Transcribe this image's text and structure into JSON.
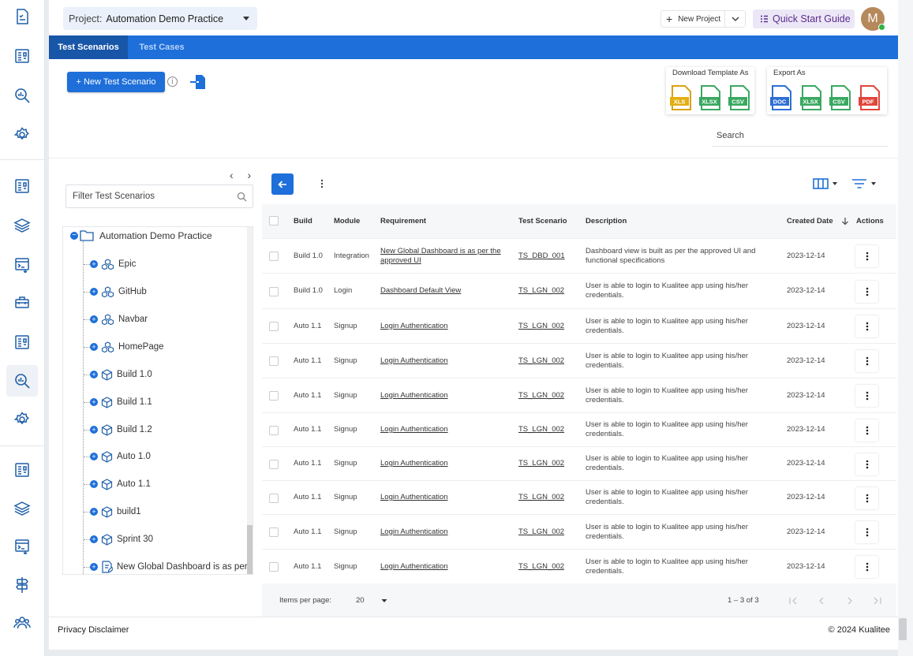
{
  "topbar": {
    "project_label": "Project:",
    "project_value": "Automation Demo Practice",
    "new_project": "New Project",
    "quick_start": "Quick Start Guide",
    "avatar_initial": "M"
  },
  "tabs": [
    {
      "label": "Test Scenarios",
      "active": true
    },
    {
      "label": "Test Cases",
      "active": false
    }
  ],
  "actions": {
    "new_scenario": "+ New Test Scenario",
    "info_glyph": "i",
    "download_title": "Download Template As",
    "download_formats": [
      "XLS",
      "XLSX",
      "CSV"
    ],
    "export_title": "Export As",
    "export_formats": [
      "DOC",
      "XLSX",
      "CSV",
      "PDF"
    ],
    "search_placeholder": "Search"
  },
  "tree": {
    "nav": "‹ ›",
    "filter_placeholder": "Filter Test Scenarios",
    "root": "Automation Demo Practice",
    "items": [
      {
        "label": "Epic",
        "icon": "modules-icon"
      },
      {
        "label": "GitHub",
        "icon": "modules-icon"
      },
      {
        "label": "Navbar",
        "icon": "modules-icon"
      },
      {
        "label": "HomePage",
        "icon": "modules-icon"
      },
      {
        "label": "Build 1.0",
        "icon": "cube-icon"
      },
      {
        "label": "Build 1.1",
        "icon": "cube-icon"
      },
      {
        "label": "Build 1.2",
        "icon": "cube-icon"
      },
      {
        "label": "Auto 1.0",
        "icon": "cube-icon"
      },
      {
        "label": "Auto 1.1",
        "icon": "cube-icon"
      },
      {
        "label": "build1",
        "icon": "cube-icon"
      },
      {
        "label": "Sprint 30",
        "icon": "cube-icon"
      },
      {
        "label": "New Global Dashboard is as per t",
        "icon": "doc-edit-icon"
      }
    ]
  },
  "table": {
    "columns": [
      "Build",
      "Module",
      "Requirement",
      "Test Scenario",
      "Description",
      "Created Date",
      "Actions"
    ],
    "rows": [
      {
        "build": "Build 1.0",
        "module": "Integration",
        "requirement": "New Global Dashboard is as per the approved UI",
        "scenario": "TS_DBD_001",
        "description": "Dashboard view is built as per the approved UI and functional specifications",
        "date": "2023-12-14"
      },
      {
        "build": "Build 1.0",
        "module": "Login",
        "requirement": "Dashboard Default View",
        "scenario": "TS_LGN_002",
        "description": "User is able to login to Kualitee app using his/her credentials.",
        "date": "2023-12-14"
      },
      {
        "build": "Auto 1.1",
        "module": "Signup",
        "requirement": "Login Authentication",
        "scenario": "TS_LGN_002",
        "description": "User is able to login to Kualitee app using his/her credentials.",
        "date": "2023-12-14"
      },
      {
        "build": "Auto 1.1",
        "module": "Signup",
        "requirement": "Login Authentication",
        "scenario": "TS_LGN_002",
        "description": "User is able to login to Kualitee app using his/her credentials.",
        "date": "2023-12-14"
      },
      {
        "build": "Auto 1.1",
        "module": "Signup",
        "requirement": "Login Authentication",
        "scenario": "TS_LGN_002",
        "description": "User is able to login to Kualitee app using his/her credentials.",
        "date": "2023-12-14"
      },
      {
        "build": "Auto 1.1",
        "module": "Signup",
        "requirement": "Login Authentication",
        "scenario": "TS_LGN_002",
        "description": "User is able to login to Kualitee app using his/her credentials.",
        "date": "2023-12-14"
      },
      {
        "build": "Auto 1.1",
        "module": "Signup",
        "requirement": "Login Authentication",
        "scenario": "TS_LGN_002",
        "description": "User is able to login to Kualitee app using his/her credentials.",
        "date": "2023-12-14"
      },
      {
        "build": "Auto 1.1",
        "module": "Signup",
        "requirement": "Login Authentication",
        "scenario": "TS_LGN_002",
        "description": "User is able to login to Kualitee app using his/her credentials.",
        "date": "2023-12-14"
      },
      {
        "build": "Auto 1.1",
        "module": "Signup",
        "requirement": "Login Authentication",
        "scenario": "TS_LGN_002",
        "description": "User is able to login to Kualitee app using his/her credentials.",
        "date": "2023-12-14"
      },
      {
        "build": "Auto 1.1",
        "module": "Signup",
        "requirement": "Login Authentication",
        "scenario": "TS_LGN_002",
        "description": "User is able to login to Kualitee app using his/her credentials.",
        "date": "2023-12-14"
      }
    ],
    "pagination": {
      "items_per_page_label": "Items per page:",
      "items_per_page": "20",
      "range": "1 – 3 of 3"
    }
  },
  "footer": {
    "left": "Privacy Disclaimer",
    "right": "© 2024 Kualitee"
  },
  "colors": {
    "primary": "#1e6fd9",
    "primary_dark": "#1856a8",
    "quick_start_bg": "#ece7f6"
  }
}
